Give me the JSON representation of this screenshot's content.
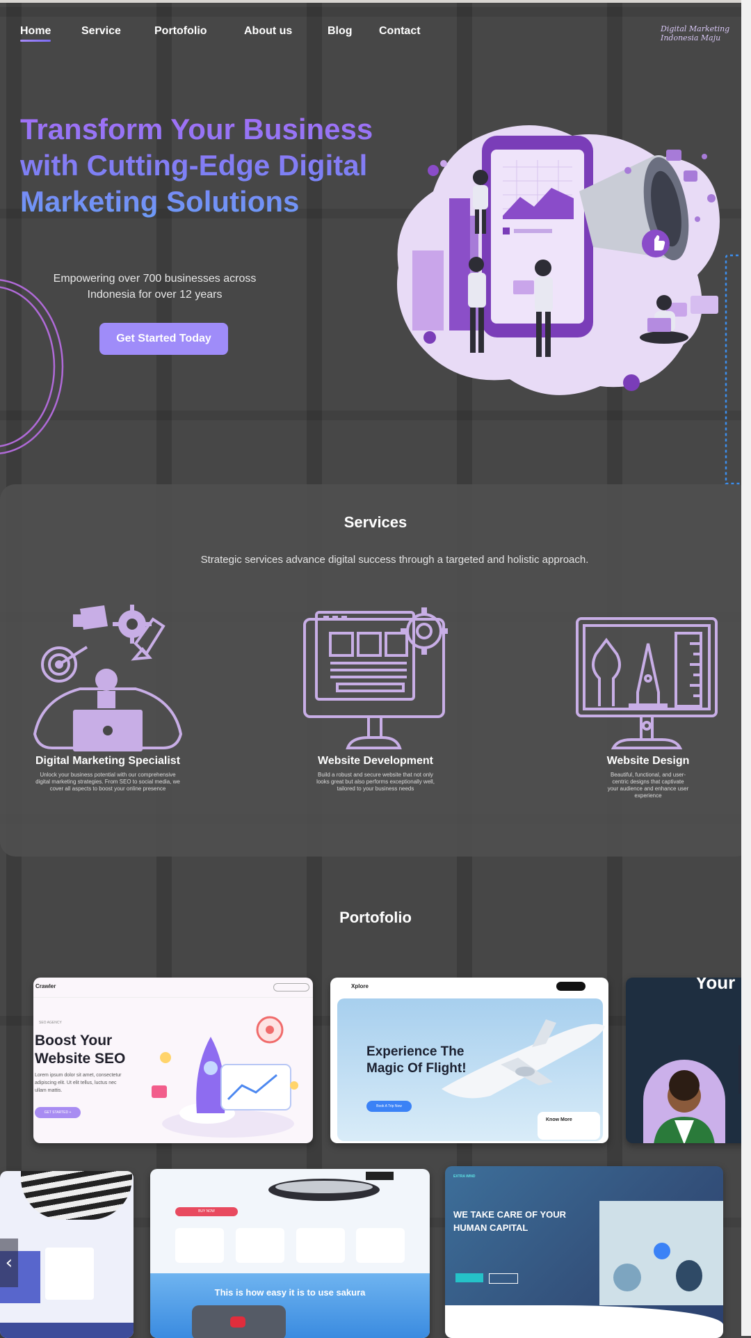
{
  "nav": {
    "items": [
      {
        "label": "Home",
        "active": true
      },
      {
        "label": "Service",
        "active": false
      },
      {
        "label": "Portofolio",
        "active": false
      },
      {
        "label": "About us",
        "active": false
      },
      {
        "label": "Blog",
        "active": false
      },
      {
        "label": "Contact",
        "active": false
      }
    ],
    "brand": "Digital Marketing Indonesia Maju"
  },
  "hero": {
    "title": "Transform Your Business with Cutting-Edge Digital Marketing Solutions",
    "subtitle": "Empowering over 700 businesses across Indonesia for over 12 years",
    "cta": "Get Started Today",
    "illustration": "digital-marketing-megaphone-illustration"
  },
  "services": {
    "title": "Services",
    "description": "Strategic services advance digital success through a targeted and holistic approach.",
    "items": [
      {
        "title": "Digital Marketing Specialist",
        "description": "Unlock your business potential with our comprehensive digital marketing strategies. From SEO to social media, we cover all aspects to boost your online presence",
        "icon": "marketing-specialist-icon"
      },
      {
        "title": "Website Development",
        "description": "Build a robust and secure website that not only looks great but also performs exceptionally well, tailored to your business needs",
        "icon": "web-development-icon"
      },
      {
        "title": "Website Design",
        "description": "Beautiful, functional, and user-centric designs that captivate your audience and enhance user experience",
        "icon": "web-design-icon"
      }
    ]
  },
  "portfolio": {
    "title": "Portofolio",
    "cards": [
      {
        "nav_brand": "Crawler",
        "headline": "Boost Your Website SEO",
        "body": "Lorem ipsum dolor sit amet, consectetur adipiscing elit. Ut elit tellus, luctus nec ullam mattis.",
        "button": "GET STARTED +",
        "tag": "SEO AGENCY"
      },
      {
        "nav_brand": "Xplore",
        "headline": "Experience The Magic Of Flight!",
        "button": "Book A Trip Now",
        "card_label": "Know More"
      },
      {
        "headline": "Your"
      },
      {
        "headline": "WE TAKE CARE OF YOUR HUMAN CAPITAL",
        "nav_brand": "EXTRA WIND"
      },
      {
        "headline": "This is how easy it is to use sakura",
        "button": "BUY NOW"
      }
    ],
    "next_arrow": "›",
    "prev_arrow": "‹"
  },
  "colors": {
    "background": "#474747",
    "accent": "#9f8cf9",
    "title_gradient_start": "#a56ef6",
    "title_gradient_end": "#6c9cf7",
    "icon_lavender": "#c8aee6"
  }
}
